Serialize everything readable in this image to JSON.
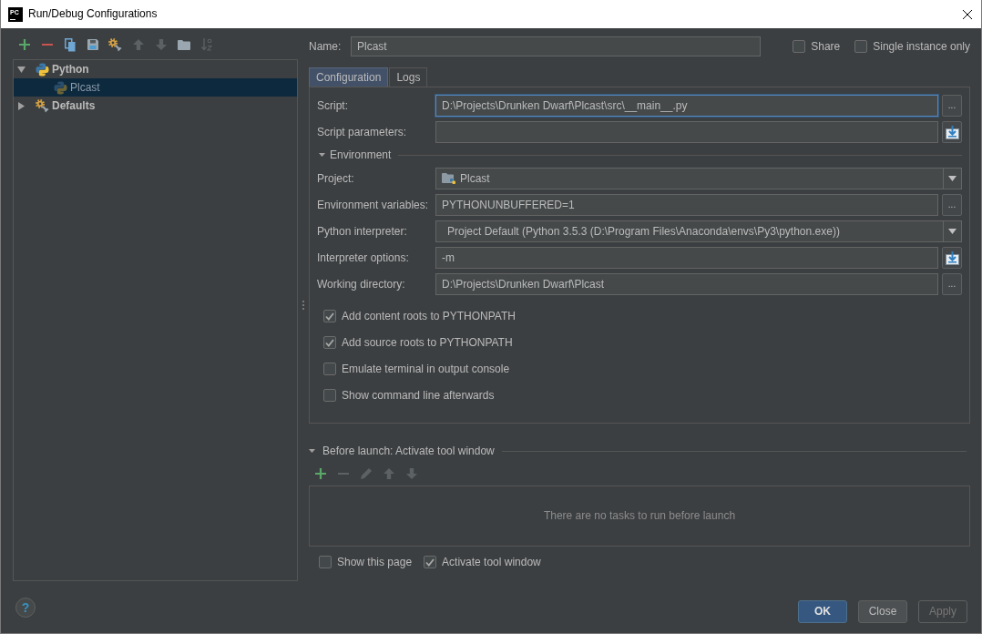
{
  "window": {
    "icon_label": "PC",
    "title": "Run/Debug Configurations"
  },
  "toolbar": [
    {
      "kind": "add",
      "disabled": false
    },
    {
      "kind": "remove",
      "disabled": false
    },
    {
      "kind": "copy",
      "disabled": false
    },
    {
      "kind": "save",
      "disabled": false
    },
    {
      "kind": "defaults",
      "disabled": false
    },
    {
      "kind": "up",
      "disabled": true
    },
    {
      "kind": "down",
      "disabled": true
    },
    {
      "kind": "folder",
      "disabled": false
    },
    {
      "kind": "sort",
      "disabled": true
    }
  ],
  "tree": [
    {
      "label": "Python",
      "kind": "python",
      "expanded": true,
      "selected": false,
      "children": [
        {
          "label": "Plcast",
          "kind": "python",
          "selected": true
        }
      ]
    },
    {
      "label": "Defaults",
      "kind": "defaults",
      "expanded": false,
      "selected": false
    }
  ],
  "name": {
    "label": "Name:",
    "value": "Plcast"
  },
  "header_options": [
    {
      "label": "Share",
      "checked": false
    },
    {
      "label": "Single instance only",
      "checked": false
    }
  ],
  "tabs": [
    {
      "label": "Configuration",
      "selected": true
    },
    {
      "label": "Logs",
      "selected": false
    }
  ],
  "configuration": {
    "fields": [
      {
        "label": "Script:",
        "kind": "text",
        "value": "D:\\Projects\\Drunken Dwarf\\Plcast\\src\\__main__.py",
        "focused": true,
        "action": {
          "kind": "browse",
          "label": "..."
        }
      },
      {
        "label": "Script parameters:",
        "kind": "text",
        "focused": false,
        "action": {
          "kind": "expand"
        }
      }
    ],
    "environment": {
      "title": "Environment",
      "expanded": true,
      "fields": [
        {
          "label": "Project:",
          "kind": "project",
          "value": "Plcast",
          "focused": false
        },
        {
          "label": "Environment variables:",
          "kind": "text",
          "value": "PYTHONUNBUFFERED=1",
          "focused": false,
          "action": {
            "kind": "browse",
            "label": "..."
          }
        },
        {
          "label": "Python interpreter:",
          "kind": "combo",
          "value": "Project Default (Python 3.5.3 (D:\\Program Files\\Anaconda\\envs\\Py3\\python.exe))",
          "focused": false
        },
        {
          "label": "Interpreter options:",
          "kind": "text",
          "value": "-m",
          "focused": false,
          "action": {
            "kind": "expand"
          }
        },
        {
          "label": "Working directory:",
          "kind": "text",
          "value": "D:\\Projects\\Drunken Dwarf\\Plcast",
          "focused": false,
          "action": {
            "kind": "browse",
            "label": "..."
          }
        }
      ]
    },
    "options": [
      {
        "label": "Add content roots to PYTHONPATH",
        "checked": true
      },
      {
        "label": "Add source roots to PYTHONPATH",
        "checked": true
      },
      {
        "label": "Emulate terminal in output console",
        "checked": false
      },
      {
        "label": "Show command line afterwards",
        "checked": false
      }
    ]
  },
  "before_launch": {
    "title": "Before launch: Activate tool window",
    "expanded": true,
    "toolbar": [
      {
        "kind": "add",
        "disabled": false
      },
      {
        "kind": "remove",
        "disabled": true
      },
      {
        "kind": "edit",
        "disabled": true
      },
      {
        "kind": "up",
        "disabled": true
      },
      {
        "kind": "down",
        "disabled": true
      }
    ],
    "empty_text": "There are no tasks to run before launch",
    "options": [
      {
        "label": "Show this page",
        "checked": false
      },
      {
        "label": "Activate tool window",
        "checked": true
      }
    ]
  },
  "help": {
    "label": "?"
  },
  "buttons": [
    {
      "label": "OK",
      "kind": "primary",
      "disabled": false
    },
    {
      "label": "Close",
      "kind": "default",
      "disabled": false
    },
    {
      "label": "Apply",
      "kind": "default",
      "disabled": true
    }
  ]
}
